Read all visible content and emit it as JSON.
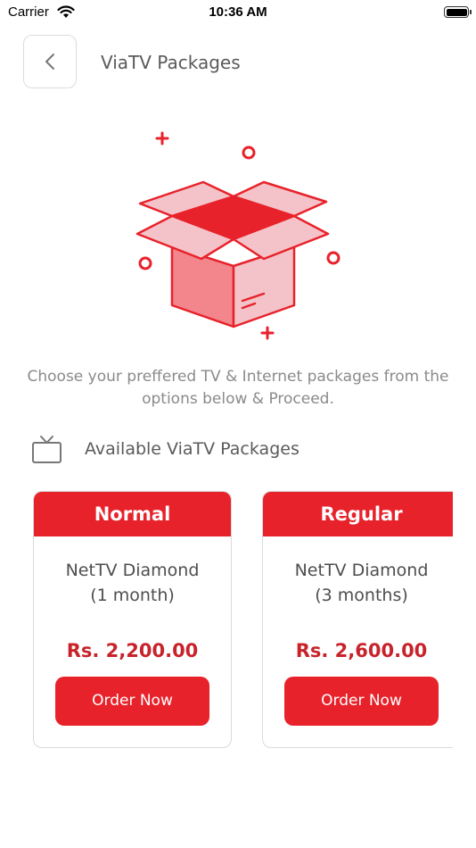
{
  "status": {
    "carrier": "Carrier",
    "time": "10:36 AM"
  },
  "header": {
    "title": "ViaTV Packages"
  },
  "intro": "Choose your preffered TV & Internet packages from the options below & Proceed.",
  "section": {
    "title": "Available ViaTV Packages"
  },
  "packages": [
    {
      "tier": "Normal",
      "name_line1": "NetTV Diamond",
      "name_line2": "(1 month)",
      "price": "Rs. 2,200.00",
      "button": "Order Now"
    },
    {
      "tier": "Regular",
      "name_line1": "NetTV Diamond",
      "name_line2": "(3 months)",
      "price": "Rs. 2,600.00",
      "button": "Order Now"
    }
  ],
  "icons": {
    "back": "chevron-left-icon",
    "tv": "tv-icon",
    "hero": "open-box-illustration",
    "wifi": "wifi-icon",
    "battery": "battery-icon"
  },
  "colors": {
    "accent": "#e8222b",
    "price": "#c8232b",
    "box_light": "#f4c3c9",
    "box_mid": "#f2868c"
  }
}
